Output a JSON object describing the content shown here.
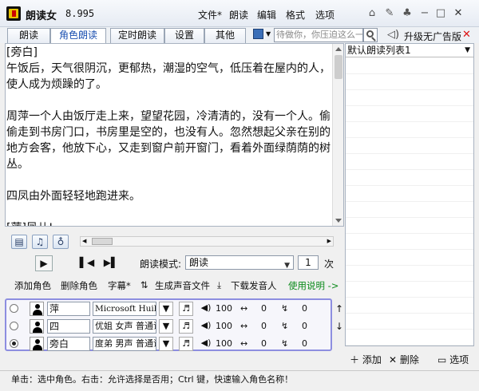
{
  "app": {
    "title": "朗读女",
    "version": "8.995"
  },
  "menu": {
    "file": "文件*",
    "read": "朗读",
    "edit": "编辑",
    "format": "格式",
    "options": "选项"
  },
  "tabs": [
    "朗读",
    "角色朗读",
    "定时朗读",
    "设置",
    "其他"
  ],
  "search": {
    "placeholder": "待做你，你压迫这么一"
  },
  "upgrade": {
    "label": "升级无广告版"
  },
  "editor": {
    "text": "[旁白]\n午饭后，天气很阴沉，更郁热，潮湿的空气，低压着在屋内的人，使人成为烦躁的了。\n\n周萍一个人由饭厅走上来，望望花园，冷清清的，没有一个人。偷偷走到书房门口，书房里是空的，也没有人。忽然想起父亲在别的地方会客，他放下心，又走到窗户前开窗门，看着外面绿荫荫的树丛。\n\n四凤由外面轻轻地跑进来。\n\n[萍]凤儿!\n[四]不，不，不看看，有人!\n[萍]没有，凤，你坐下。"
  },
  "right_panel": {
    "list_name": "默认朗读列表1",
    "add": "添加",
    "delete": "删除",
    "options": "选项"
  },
  "player": {
    "mode_label": "朗读模式:",
    "mode_value": "朗读",
    "count_value": "1",
    "count_unit": "次"
  },
  "actions": {
    "add_role": "添加角色",
    "delete_role": "删除角色",
    "subtitle": "字幕*",
    "generate_audio": "生成声音文件",
    "download_voice": "下载发音人",
    "help": "使用说明 ->"
  },
  "voices": [
    {
      "name": "萍",
      "engine": "Microsoft Huihui",
      "volume": "100",
      "speed": "0",
      "pitch": "0",
      "selected": false
    },
    {
      "name": "四",
      "engine": "优姐 女声 普通话",
      "volume": "100",
      "speed": "0",
      "pitch": "0",
      "selected": false
    },
    {
      "name": "旁白",
      "engine": "度弟 男声 普通话",
      "volume": "100",
      "speed": "0",
      "pitch": "0",
      "selected": true
    }
  ],
  "status": {
    "text": "单击：选中角色。右击：允许选择是否用；Ctrl 键，快速输入角色名称！"
  },
  "colors": {
    "voice_box_border": "#8d8ee0",
    "help_link": "#0a8a1a",
    "close": "#d11"
  }
}
